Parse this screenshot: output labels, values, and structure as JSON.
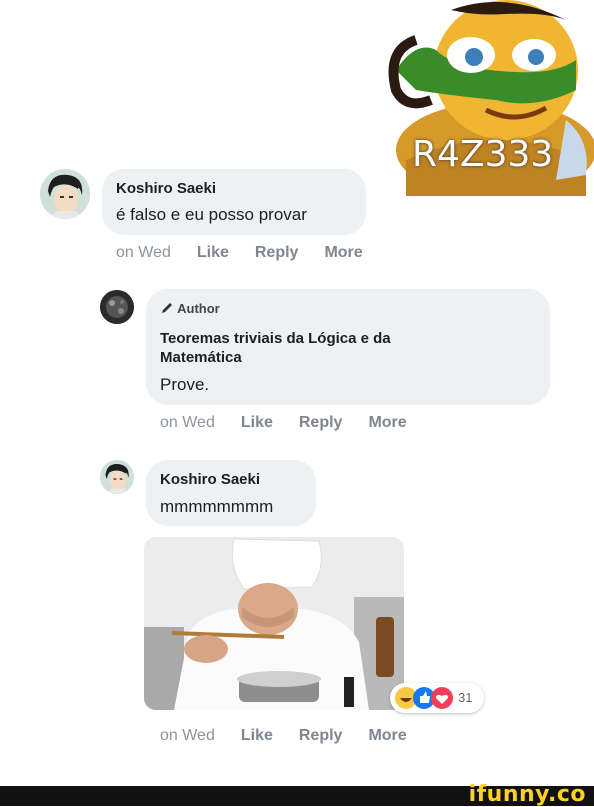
{
  "corner_badge": {
    "text": "R4Z333"
  },
  "comments": [
    {
      "name": "Koshiro Saeki",
      "text": "é falso e eu posso provar",
      "actions": {
        "time": "on Wed",
        "like": "Like",
        "reply": "Reply",
        "more": "More"
      }
    },
    {
      "badge": "Author",
      "name": "Teoremas triviais da Lógica e da Matemática",
      "text": "Prove.",
      "actions": {
        "time": "on Wed",
        "like": "Like",
        "reply": "Reply",
        "more": "More"
      }
    },
    {
      "name": "Koshiro Saeki",
      "text": "mmmmmmmm",
      "reactions_count": "31",
      "actions": {
        "time": "on Wed",
        "like": "Like",
        "reply": "Reply",
        "more": "More"
      }
    }
  ],
  "footer": {
    "brand": "ifunny.co"
  },
  "colors": {
    "bubble": "#eef0f3",
    "meta": "#8d949e",
    "brand": "#ffd21f"
  }
}
